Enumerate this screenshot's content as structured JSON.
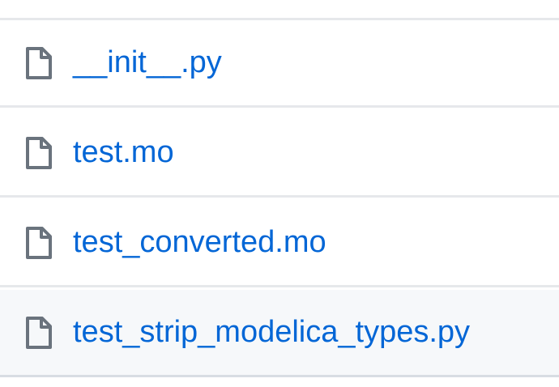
{
  "files": [
    {
      "name": "__init__.py",
      "icon": "file-icon"
    },
    {
      "name": "test.mo",
      "icon": "file-icon"
    },
    {
      "name": "test_converted.mo",
      "icon": "file-icon"
    },
    {
      "name": "test_strip_modelica_types.py",
      "icon": "file-icon"
    }
  ],
  "colors": {
    "link": "#0366d6",
    "icon": "#6a737d",
    "border": "#e6e8eb",
    "hover_row": "#f6f8fa"
  }
}
